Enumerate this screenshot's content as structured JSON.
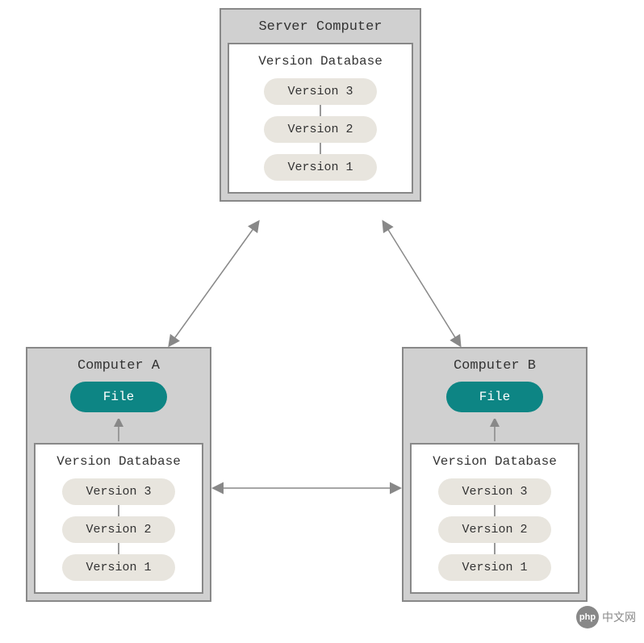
{
  "server": {
    "title": "Server Computer",
    "db_title": "Version Database",
    "versions": [
      "Version 3",
      "Version 2",
      "Version 1"
    ]
  },
  "computerA": {
    "title": "Computer A",
    "file_label": "File",
    "db_title": "Version Database",
    "versions": [
      "Version 3",
      "Version 2",
      "Version 1"
    ]
  },
  "computerB": {
    "title": "Computer B",
    "file_label": "File",
    "db_title": "Version Database",
    "versions": [
      "Version 3",
      "Version 2",
      "Version 1"
    ]
  },
  "watermark": {
    "logo": "php",
    "text": "中文网"
  }
}
